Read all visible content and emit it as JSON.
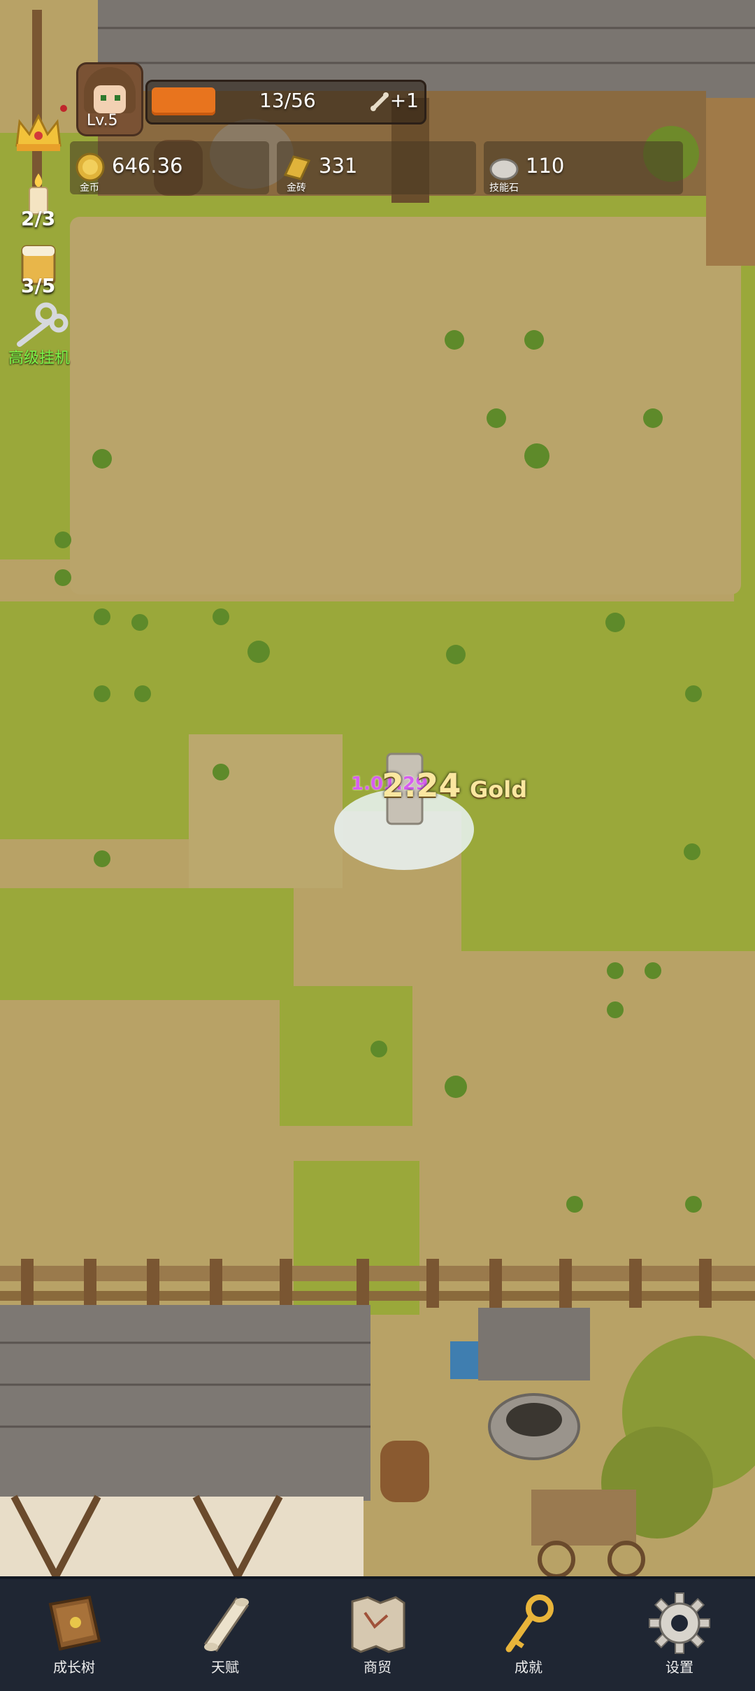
{
  "player": {
    "level": "Lv.5"
  },
  "xp": {
    "text": "13/56",
    "fraction": 0.236,
    "bonus": "+1"
  },
  "resources": [
    {
      "icon": "gold-coin-icon",
      "value": "646.36",
      "label": "金币"
    },
    {
      "icon": "gold-brick-icon",
      "value": "331",
      "label": "金砖"
    },
    {
      "icon": "skill-stone-icon",
      "value": "110",
      "label": "技能石"
    }
  ],
  "side": {
    "candle_count": "2/3",
    "beer_count": "3/5",
    "idle_label": "高级挂机"
  },
  "floating": {
    "damage": "1.01.29",
    "gold_amount": "2.24",
    "gold_unit": "Gold"
  },
  "nav": [
    {
      "label": "成长树",
      "icon": "book-icon"
    },
    {
      "label": "天赋",
      "icon": "scroll-icon"
    },
    {
      "label": "商贸",
      "icon": "map-icon"
    },
    {
      "label": "成就",
      "icon": "key-icon"
    },
    {
      "label": "设置",
      "icon": "gear-icon"
    }
  ],
  "colors": {
    "grass": "#9aa83a",
    "dirt": "#b8a266",
    "xp_fill": "#e8741e",
    "nav_bg": "#1f2633",
    "idle_text": "#7bf548"
  }
}
